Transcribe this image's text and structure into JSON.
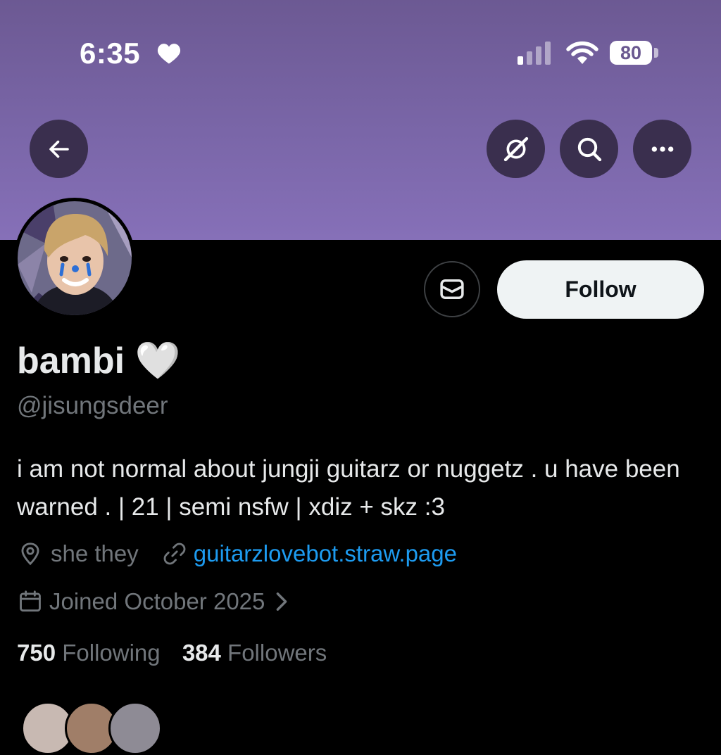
{
  "status_bar": {
    "time": "6:35",
    "battery": "80"
  },
  "header": {
    "back_icon": "arrow-left-icon",
    "grok_icon": "grok-slash-icon",
    "search_icon": "search-icon",
    "more_icon": "more-horizontal-icon",
    "banner_color": "#7a66a8"
  },
  "profile": {
    "display_name": "bambi 🤍",
    "handle": "@jisungsdeer",
    "bio": "i am not normal about jungji guitarz or nuggetz . u have been warned . | 21 | semi nsfw | xdiz + skz :3",
    "location": "she they",
    "website": "guitarzlovebot.straw.page",
    "joined": "Joined October 2025"
  },
  "actions": {
    "message_icon": "envelope-icon",
    "follow_label": "Follow"
  },
  "stats": {
    "following_count": "750",
    "following_label": "Following",
    "followers_count": "384",
    "followers_label": "Followers"
  }
}
